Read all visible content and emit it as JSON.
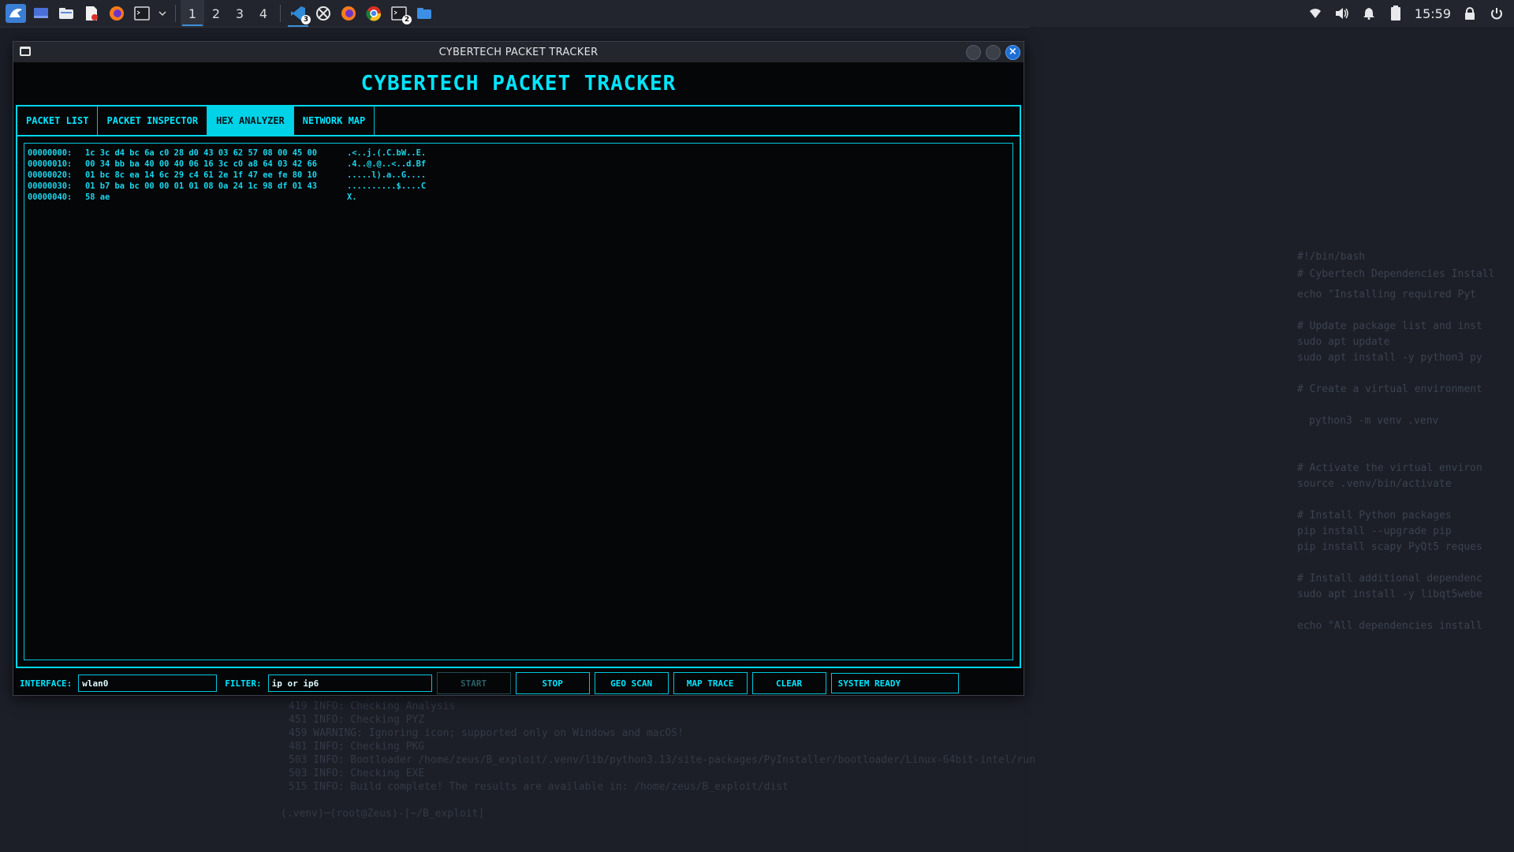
{
  "taskbar": {
    "workspaces": [
      "1",
      "2",
      "3",
      "4"
    ],
    "active_workspace": "1",
    "vscode_badge": "3",
    "terminal_badge": "2",
    "clock": "15:59"
  },
  "window": {
    "title": "CYBERTECH PACKET TRACKER"
  },
  "app": {
    "header": "CYBERTECH PACKET TRACKER",
    "tabs": [
      {
        "label": "PACKET LIST"
      },
      {
        "label": "PACKET INSPECTOR"
      },
      {
        "label": "HEX ANALYZER"
      },
      {
        "label": "NETWORK MAP"
      }
    ],
    "active_tab": "HEX ANALYZER",
    "hex_rows": [
      {
        "offset": "00000000:",
        "bytes": "1c 3c d4 bc 6a c0 28 d0 43 03 62 57 08 00 45 00",
        "ascii": ".<..j.(.C.bW..E."
      },
      {
        "offset": "00000010:",
        "bytes": "00 34 bb ba 40 00 40 06 16 3c c0 a8 64 03 42 66",
        "ascii": ".4..@.@..<..d.Bf"
      },
      {
        "offset": "00000020:",
        "bytes": "01 bc 8c ea 14 6c 29 c4 61 2e 1f 47 ee fe 80 10",
        "ascii": ".....l).a..G...."
      },
      {
        "offset": "00000030:",
        "bytes": "01 b7 ba bc 00 00 01 01 08 0a 24 1c 98 df 01 43",
        "ascii": "..........$....C"
      },
      {
        "offset": "00000040:",
        "bytes": "58 ae",
        "ascii": "X."
      }
    ],
    "controls": {
      "interface_label": "INTERFACE:",
      "interface_value": "wlan0",
      "filter_label": "FILTER:",
      "filter_value": "ip or ip6",
      "start": "START",
      "stop": "STOP",
      "geo_scan": "GEO SCAN",
      "map_trace": "MAP TRACE",
      "clear": "CLEAR",
      "status": "SYSTEM READY"
    }
  },
  "background": {
    "terminal_lines": [
      "419 INFO: Checking Analysis",
      "451 INFO: Checking PYZ",
      "459 WARNING: Ignoring icon; supported only on Windows and macOS!",
      "481 INFO: Checking PKG",
      "503 INFO: Bootloader /home/zeus/B_exploit/.venv/lib/python3.13/site-packages/PyInstaller/bootloader/Linux-64bit-intel/run",
      "503 INFO: Checking EXE",
      "515 INFO: Build complete! The results are available in: /home/zeus/B_exploit/dist"
    ],
    "prompt": "(.venv)─(root@Zeus)-[~/B_exploit]",
    "editor_lines": [
      "#!/bin/bash",
      "# Cybertech Dependencies Install",
      "echo \"Installing required Pyt",
      "# Update package list and inst",
      "sudo apt update",
      "sudo apt install -y python3 py",
      "# Create a virtual environment",
      "python3 -m venv .venv",
      "# Activate the virtual environ",
      "source .venv/bin/activate",
      "# Install Python packages",
      "pip install --upgrade pip",
      "pip install scapy PyQt5 reques",
      "# Install additional dependenc",
      "sudo apt install -y libqt5webe",
      "echo \"All dependencies install"
    ]
  },
  "colors": {
    "accent": "#00e5ff",
    "window_bg": "#050607",
    "desktop_bg": "#1b1e27"
  }
}
